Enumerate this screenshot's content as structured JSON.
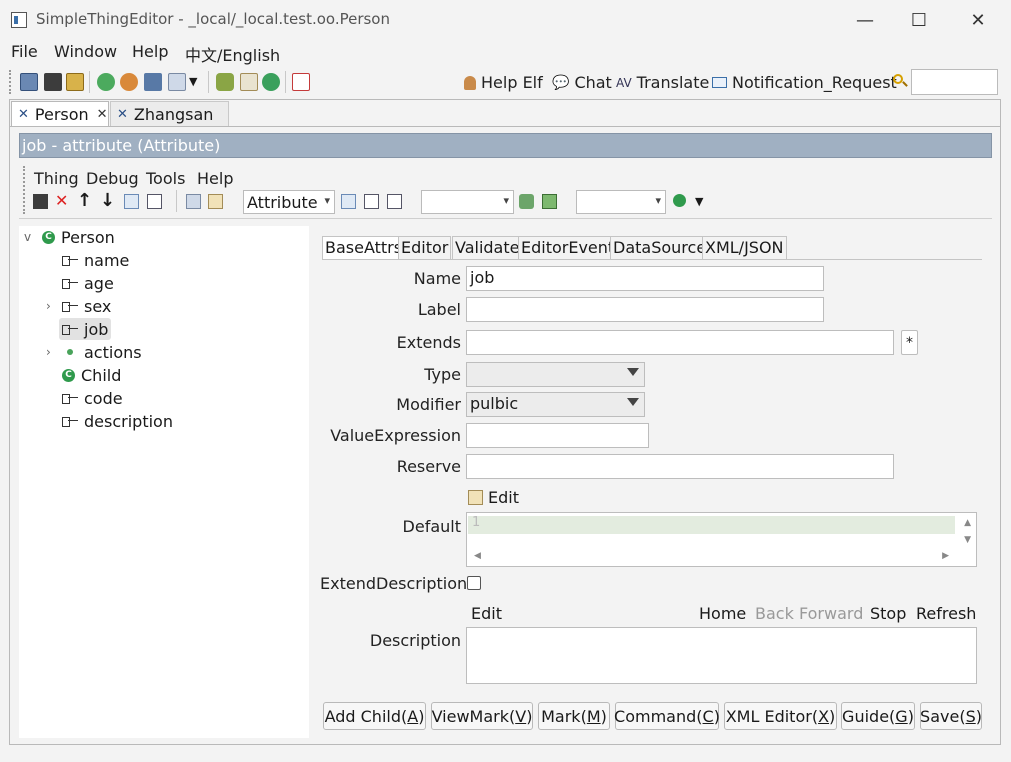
{
  "window": {
    "title": "SimpleThingEditor - _local/_local.test.oo.Person",
    "minimize": "—",
    "maximize": "☐",
    "close": "✕"
  },
  "menubar": [
    "File",
    "Window",
    "Help",
    "中文/English"
  ],
  "toolbar_right": {
    "help_elf": "Help Elf",
    "chat": "Chat",
    "translate": "Translate",
    "notification": "Notification_Request",
    "search_value": ""
  },
  "tabs": [
    {
      "label": "Person",
      "close": "✕"
    },
    {
      "label": "Zhangsan"
    }
  ],
  "header": "job - attribute  (Attribute)",
  "editor_menu": [
    "Thing",
    "Debug",
    "Tools",
    "Help"
  ],
  "editor_toolbar": {
    "type_combo": "Attribute",
    "combo2": "",
    "combo3": ""
  },
  "tree": {
    "root": "Person",
    "items": [
      "name",
      "age",
      "sex",
      "job",
      "actions",
      "Child",
      "code",
      "description"
    ],
    "selected": "job"
  },
  "detail_tabs": [
    "BaseAttrs",
    "Editor",
    "Validate",
    "EditorEvent",
    "DataSource",
    "XML/JSON"
  ],
  "form": {
    "name_label": "Name",
    "name_value": "job",
    "label_label": "Label",
    "label_value": "",
    "extends_label": "Extends",
    "extends_value": "",
    "extends_star": "*",
    "type_label": "Type",
    "type_value": "",
    "modifier_label": "Modifier",
    "modifier_value": "pulbic",
    "valueexpr_label": "ValueExpression",
    "valueexpr_value": "",
    "reserve_label": "Reserve",
    "reserve_value": "",
    "edit_link": "Edit",
    "default_label": "Default",
    "default_line_no": "1",
    "extdesc_label": "ExtendDescription",
    "desc_label": "Description",
    "desc_toolbar": {
      "edit": "Edit",
      "home": "Home",
      "back": "Back",
      "forward": "Forward",
      "stop": "Stop",
      "refresh": "Refresh"
    }
  },
  "buttons": [
    {
      "text": "Add Child(",
      "key": "A",
      "end": ")"
    },
    {
      "text": "ViewMark(",
      "key": "V",
      "end": ")"
    },
    {
      "text": "Mark(",
      "key": "M",
      "end": ")"
    },
    {
      "text": "Command(",
      "key": "C",
      "end": ")"
    },
    {
      "text": "XML Editor(",
      "key": "X",
      "end": ")"
    },
    {
      "text": "Guide(",
      "key": "G",
      "end": ")"
    },
    {
      "text": "Save(",
      "key": "S",
      "end": ")"
    }
  ]
}
